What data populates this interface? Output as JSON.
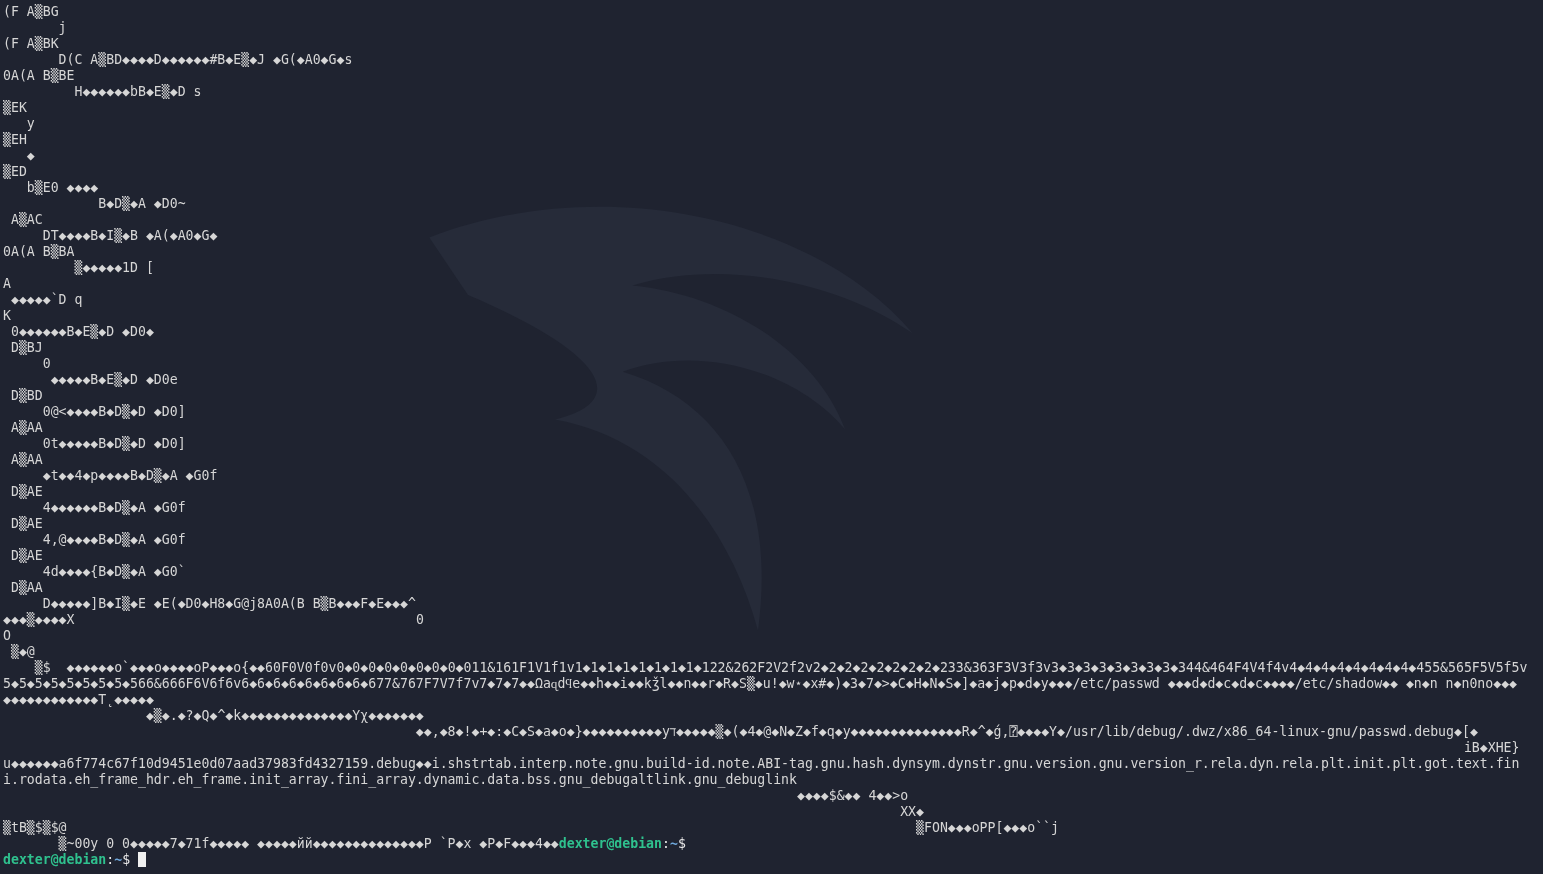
{
  "terminal": {
    "lines": [
      {
        "segments": [
          "(F A▒BG"
        ]
      },
      {
        "segments": [
          "       j"
        ]
      },
      {
        "segments": [
          "(F A▒BK"
        ]
      },
      {
        "segments": [
          "       D(C A▒BD◆◆◆◆D◆◆◆◆◆◆#B◆E▒◆J ◆G(◆A0◆G◆s"
        ]
      },
      {
        "segments": [
          "0A(A B▒BE"
        ]
      },
      {
        "segments": [
          "         H◆◆◆◆◆◆bB◆E▒◆D s"
        ]
      },
      {
        "segments": [
          "▒EK"
        ]
      },
      {
        "segments": [
          "   y"
        ]
      },
      {
        "segments": [
          "▒EH"
        ]
      },
      {
        "segments": [
          "   ◆"
        ]
      },
      {
        "segments": [
          "▒ED"
        ]
      },
      {
        "segments": [
          "   b▒E0 ◆◆◆◆"
        ]
      },
      {
        "segments": [
          "            B◆D▒◆A ◆D0~"
        ]
      },
      {
        "segments": [
          " A▒AC"
        ]
      },
      {
        "segments": [
          "     DT◆◆◆◆B◆I▒◆B ◆A(◆A0◆G◆"
        ]
      },
      {
        "segments": [
          "0A(A B▒BA"
        ]
      },
      {
        "segments": [
          "         ▒◆◆◆◆◆1D ["
        ]
      },
      {
        "segments": [
          "A"
        ]
      },
      {
        "segments": [
          " ◆◆◆◆◆`D q"
        ]
      },
      {
        "segments": [
          "K"
        ]
      },
      {
        "segments": [
          " 0◆◆◆◆◆◆B◆E▒◆D ◆D0◆"
        ]
      },
      {
        "segments": [
          " D▒BJ"
        ]
      },
      {
        "segments": [
          "     0"
        ]
      },
      {
        "segments": [
          "      ◆◆◆◆◆B◆E▒◆D ◆D0e"
        ]
      },
      {
        "segments": [
          " D▒BD"
        ]
      },
      {
        "segments": [
          "     0@<◆◆◆◆B◆D▒◆D ◆D0]"
        ]
      },
      {
        "segments": [
          " A▒AA"
        ]
      },
      {
        "segments": [
          "     0t◆◆◆◆◆B◆D▒◆D ◆D0]"
        ]
      },
      {
        "segments": [
          " A▒AA"
        ]
      },
      {
        "segments": [
          "     ◆t◆◆4◆p◆◆◆◆B◆D▒◆A ◆G0f"
        ]
      },
      {
        "segments": [
          " D▒AE"
        ]
      },
      {
        "segments": [
          "     4◆◆◆◆◆◆B◆D▒◆A ◆G0f"
        ]
      },
      {
        "segments": [
          " D▒AE"
        ]
      },
      {
        "segments": [
          "     4,@◆◆◆◆B◆D▒◆A ◆G0f"
        ]
      },
      {
        "segments": [
          " D▒AE"
        ]
      },
      {
        "segments": [
          "     4d◆◆◆◆{B◆D▒◆A ◆G0`"
        ]
      },
      {
        "segments": [
          " D▒AA"
        ]
      },
      {
        "segments": [
          "     D◆◆◆◆◆]B◆I▒◆E ◆E(◆D0◆H8◆G@j8A0A(B B▒B◆◆◆F◆E◆◆◆^"
        ]
      },
      {
        "segments": [
          "◆◆◆▒◆◆◆◆X",
          "                                           0"
        ]
      },
      {
        "segments": [
          "O"
        ]
      },
      {
        "segments": [
          " ▒◆@"
        ]
      },
      {
        "segments": [
          "    ▒$",
          "  ◆◆◆◆◆◆o`◆◆◆o◆◆◆◆oP◆◆◆o{◆◆60F0V0f0v0◆0◆0◆0◆0◆0◆0◆0◆011&161F1V1f1v1◆1◆1◆1◆1◆1◆1◆1◆122&262F2V2f2v2◆2◆2◆2◆2◆2◆2◆2◆233&363F3V3f3v3◆3◆3◆3◆3◆3◆3◆3◆344&464F4V4f4v4◆4◆4◆4◆4◆4◆4◆4◆455&565F5V5f5v"
        ]
      },
      {
        "segments": [
          "5◆5◆5◆5◆5◆5◆5◆5◆566&666F6V6f6v6◆6◆6◆6◆6◆6◆6◆6◆677&767F7V7f7v7◆7◆7◆◆Ωaɋdϥe◆◆h◆◆i◆◆kǯl◆◆n◆◆r◆R◆S▒◆u!◆w⋆◆x#◆)◆3◆7◆>◆C◆H◆N◆S◆]◆a◆j◆p◆d◆y◆◆◆/etc/passwd ◆◆◆d◆d◆c◆d◆c◆◆◆◆/etc/shadow◆◆ ◆n◆n n◆n0no◆◆◆"
        ]
      },
      {
        "segments": [
          "◆◆◆◆◆◆◆◆◆◆◆◆T˛◆◆◆◆◆"
        ]
      },
      {
        "segments": [
          "                  ◆▒◆.◆?◆Q◆^◆k◆◆◆◆◆◆◆◆◆◆◆◆◆◆Yχ◆◆◆◆◆◆◆"
        ]
      },
      {
        "segments": [
          "                                                    ◆◆,◆8◆!◆+◆:◆C◆S◆a◆o◆}◆◆◆◆◆◆◆◆◆◆yℸ◆◆◆◆◆▒◆(◆4◆@◆N◆Z◆f◆q◆y◆◆◆◆◆◆◆◆◆◆◆◆◆◆R◆^◆ǵ,⍰◆◆◆◆Y◆/usr/lib/debug/.dwz/x86_64-linux-gnu/passwd.debug◆[◆"
        ]
      },
      {
        "segments": [
          "                                                                                                                                                                                        iB◆XHE}"
        ]
      },
      {
        "segments": [
          "u◆◆◆◆◆◆a6f774c67f10d9451e0d07aad37983fd4327159.debug◆◆i.shstrtab.interp.note.gnu.build-id.note.ABI-tag.gnu.hash.dynsym.dynstr.gnu.version.gnu.version_r.rela.dyn.rela.plt.init.plt.got.text.fin"
        ]
      },
      {
        "segments": [
          "i.rodata.eh_frame_hdr.eh_frame.init_array.fini_array.dynamic.data.bss.gnu_debugaltlink.gnu_debuglink"
        ]
      },
      {
        "segments": [
          "                                                                                                    ◆◆◆◆$&◆◆ 4◆◆>o"
        ]
      },
      {
        "segments": [
          "                                                                                                                 XX◆"
        ]
      },
      {
        "segments": [
          "▒tB▒$▒$@",
          "                                                                                                           ▒FON◆◆◆oPP[◆◆◆o``j"
        ]
      },
      {
        "segments": [
          "       ▒~00y 0 0◆◆◆◆◆7◆71f◆◆◆◆◆ ◆◆◆◆◆йй◆◆◆◆◆◆◆◆◆◆◆◆◆◆P `P◆x ◆P◆F◆◆◆4◆◆"
        ],
        "prompt": {
          "user_host": "dexter@debian",
          "separator": ":",
          "path": "~",
          "symbol": "$"
        }
      },
      {
        "prompt": {
          "user_host": "dexter@debian",
          "separator": ":",
          "path": "~",
          "symbol": "$"
        },
        "cursor": true
      }
    ]
  }
}
